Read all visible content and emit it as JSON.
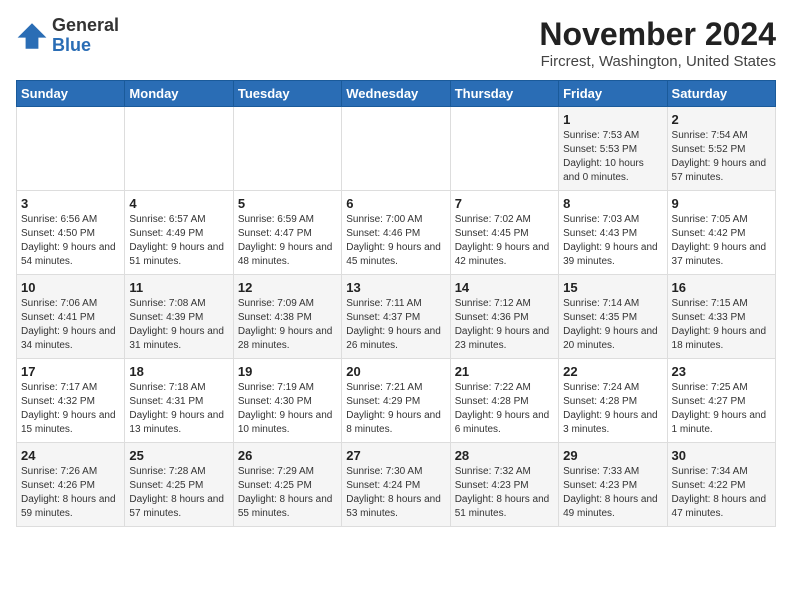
{
  "logo": {
    "general": "General",
    "blue": "Blue"
  },
  "header": {
    "month_title": "November 2024",
    "location": "Fircrest, Washington, United States"
  },
  "days_of_week": [
    "Sunday",
    "Monday",
    "Tuesday",
    "Wednesday",
    "Thursday",
    "Friday",
    "Saturday"
  ],
  "weeks": [
    [
      {
        "day": "",
        "info": ""
      },
      {
        "day": "",
        "info": ""
      },
      {
        "day": "",
        "info": ""
      },
      {
        "day": "",
        "info": ""
      },
      {
        "day": "",
        "info": ""
      },
      {
        "day": "1",
        "info": "Sunrise: 7:53 AM\nSunset: 5:53 PM\nDaylight: 10 hours and 0 minutes."
      },
      {
        "day": "2",
        "info": "Sunrise: 7:54 AM\nSunset: 5:52 PM\nDaylight: 9 hours and 57 minutes."
      }
    ],
    [
      {
        "day": "3",
        "info": "Sunrise: 6:56 AM\nSunset: 4:50 PM\nDaylight: 9 hours and 54 minutes."
      },
      {
        "day": "4",
        "info": "Sunrise: 6:57 AM\nSunset: 4:49 PM\nDaylight: 9 hours and 51 minutes."
      },
      {
        "day": "5",
        "info": "Sunrise: 6:59 AM\nSunset: 4:47 PM\nDaylight: 9 hours and 48 minutes."
      },
      {
        "day": "6",
        "info": "Sunrise: 7:00 AM\nSunset: 4:46 PM\nDaylight: 9 hours and 45 minutes."
      },
      {
        "day": "7",
        "info": "Sunrise: 7:02 AM\nSunset: 4:45 PM\nDaylight: 9 hours and 42 minutes."
      },
      {
        "day": "8",
        "info": "Sunrise: 7:03 AM\nSunset: 4:43 PM\nDaylight: 9 hours and 39 minutes."
      },
      {
        "day": "9",
        "info": "Sunrise: 7:05 AM\nSunset: 4:42 PM\nDaylight: 9 hours and 37 minutes."
      }
    ],
    [
      {
        "day": "10",
        "info": "Sunrise: 7:06 AM\nSunset: 4:41 PM\nDaylight: 9 hours and 34 minutes."
      },
      {
        "day": "11",
        "info": "Sunrise: 7:08 AM\nSunset: 4:39 PM\nDaylight: 9 hours and 31 minutes."
      },
      {
        "day": "12",
        "info": "Sunrise: 7:09 AM\nSunset: 4:38 PM\nDaylight: 9 hours and 28 minutes."
      },
      {
        "day": "13",
        "info": "Sunrise: 7:11 AM\nSunset: 4:37 PM\nDaylight: 9 hours and 26 minutes."
      },
      {
        "day": "14",
        "info": "Sunrise: 7:12 AM\nSunset: 4:36 PM\nDaylight: 9 hours and 23 minutes."
      },
      {
        "day": "15",
        "info": "Sunrise: 7:14 AM\nSunset: 4:35 PM\nDaylight: 9 hours and 20 minutes."
      },
      {
        "day": "16",
        "info": "Sunrise: 7:15 AM\nSunset: 4:33 PM\nDaylight: 9 hours and 18 minutes."
      }
    ],
    [
      {
        "day": "17",
        "info": "Sunrise: 7:17 AM\nSunset: 4:32 PM\nDaylight: 9 hours and 15 minutes."
      },
      {
        "day": "18",
        "info": "Sunrise: 7:18 AM\nSunset: 4:31 PM\nDaylight: 9 hours and 13 minutes."
      },
      {
        "day": "19",
        "info": "Sunrise: 7:19 AM\nSunset: 4:30 PM\nDaylight: 9 hours and 10 minutes."
      },
      {
        "day": "20",
        "info": "Sunrise: 7:21 AM\nSunset: 4:29 PM\nDaylight: 9 hours and 8 minutes."
      },
      {
        "day": "21",
        "info": "Sunrise: 7:22 AM\nSunset: 4:28 PM\nDaylight: 9 hours and 6 minutes."
      },
      {
        "day": "22",
        "info": "Sunrise: 7:24 AM\nSunset: 4:28 PM\nDaylight: 9 hours and 3 minutes."
      },
      {
        "day": "23",
        "info": "Sunrise: 7:25 AM\nSunset: 4:27 PM\nDaylight: 9 hours and 1 minute."
      }
    ],
    [
      {
        "day": "24",
        "info": "Sunrise: 7:26 AM\nSunset: 4:26 PM\nDaylight: 8 hours and 59 minutes."
      },
      {
        "day": "25",
        "info": "Sunrise: 7:28 AM\nSunset: 4:25 PM\nDaylight: 8 hours and 57 minutes."
      },
      {
        "day": "26",
        "info": "Sunrise: 7:29 AM\nSunset: 4:25 PM\nDaylight: 8 hours and 55 minutes."
      },
      {
        "day": "27",
        "info": "Sunrise: 7:30 AM\nSunset: 4:24 PM\nDaylight: 8 hours and 53 minutes."
      },
      {
        "day": "28",
        "info": "Sunrise: 7:32 AM\nSunset: 4:23 PM\nDaylight: 8 hours and 51 minutes."
      },
      {
        "day": "29",
        "info": "Sunrise: 7:33 AM\nSunset: 4:23 PM\nDaylight: 8 hours and 49 minutes."
      },
      {
        "day": "30",
        "info": "Sunrise: 7:34 AM\nSunset: 4:22 PM\nDaylight: 8 hours and 47 minutes."
      }
    ]
  ]
}
